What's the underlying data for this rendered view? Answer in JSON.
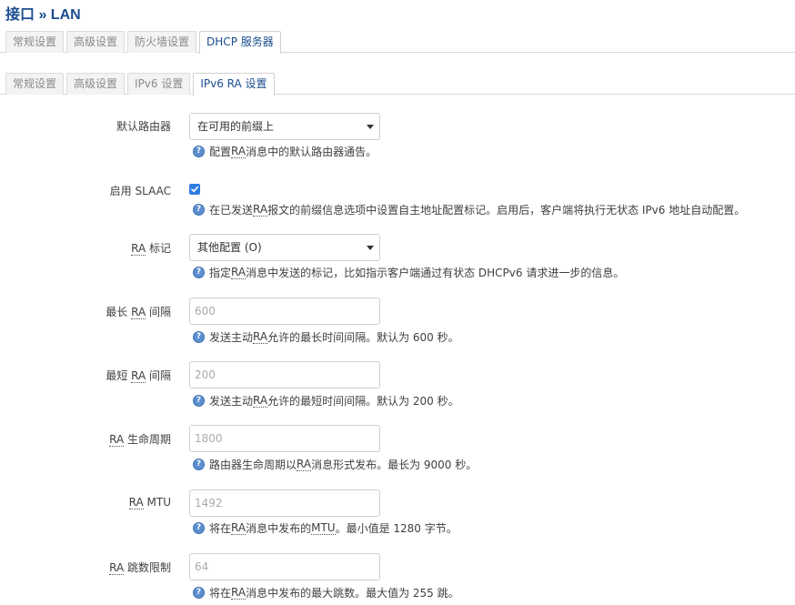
{
  "page": {
    "title": "接口 » LAN"
  },
  "tabs_primary": [
    {
      "label": "常规设置",
      "active": false
    },
    {
      "label": "高级设置",
      "active": false
    },
    {
      "label": "防火墙设置",
      "active": false
    },
    {
      "label": "DHCP 服务器",
      "active": true
    }
  ],
  "tabs_secondary": [
    {
      "label": "常规设置",
      "active": false
    },
    {
      "label": "高级设置",
      "active": false
    },
    {
      "label": "IPv6 设置",
      "active": false
    },
    {
      "label": "IPv6 RA 设置",
      "active": true
    }
  ],
  "fields": {
    "default_router": {
      "label": "默认路由器",
      "value": "在可用的前缀上",
      "help_pre": "配置 ",
      "help_abbr": "RA",
      "help_post": " 消息中的默认路由器通告。"
    },
    "slaac": {
      "label": "启用 SLAAC",
      "checked": true,
      "help_pre": "在已发送 ",
      "help_abbr": "RA",
      "help_post": " 报文的前缀信息选项中设置自主地址配置标记。启用后，客户端将执行无状态 IPv6 地址自动配置。"
    },
    "ra_flags": {
      "label_abbr": "RA",
      "label_post": " 标记",
      "value": "其他配置 (O)",
      "help_pre": "指定",
      "help_abbr": "RA",
      "help_post": "消息中发送的标记，比如指示客户端通过有状态 DHCPv6 请求进一步的信息。"
    },
    "max_interval": {
      "label_pre": "最长 ",
      "label_abbr": "RA",
      "label_post": " 间隔",
      "placeholder": "600",
      "help_pre": "发送主动 ",
      "help_abbr": "RA",
      "help_post": " 允许的最长时间间隔。默认为 600 秒。"
    },
    "min_interval": {
      "label_pre": "最短 ",
      "label_abbr": "RA",
      "label_post": " 间隔",
      "placeholder": "200",
      "help_pre": "发送主动 ",
      "help_abbr": "RA",
      "help_post": " 允许的最短时间间隔。默认为 200 秒。"
    },
    "lifetime": {
      "label_abbr": "RA",
      "label_post": " 生命周期",
      "placeholder": "1800",
      "help_pre": "路由器生命周期以 ",
      "help_abbr": "RA",
      "help_post": " 消息形式发布。最长为 9000 秒。"
    },
    "mtu": {
      "label_abbr": "RA",
      "label_post": " MTU",
      "placeholder": "1492",
      "help_pre": "将在 ",
      "help_abbr": "RA",
      "help_mid": "消息中发布的",
      "help_abbr2": "MTU",
      "help_post": "。最小值是 1280 字节。"
    },
    "hop_limit": {
      "label_abbr": "RA",
      "label_post": " 跳数限制",
      "placeholder": "64",
      "help_pre": "将在 ",
      "help_abbr": "RA",
      "help_post": "消息中发布的最大跳数。最大值为 255 跳。"
    }
  },
  "icons": {
    "help": "help-question-icon",
    "help_glyph": "?",
    "dropdown": "chevron-down-icon",
    "check": "checkmark-icon"
  },
  "colors": {
    "title": "#1a4d8f",
    "checkbox": "#2f7de1",
    "help_icon": "#5d8fcf"
  }
}
